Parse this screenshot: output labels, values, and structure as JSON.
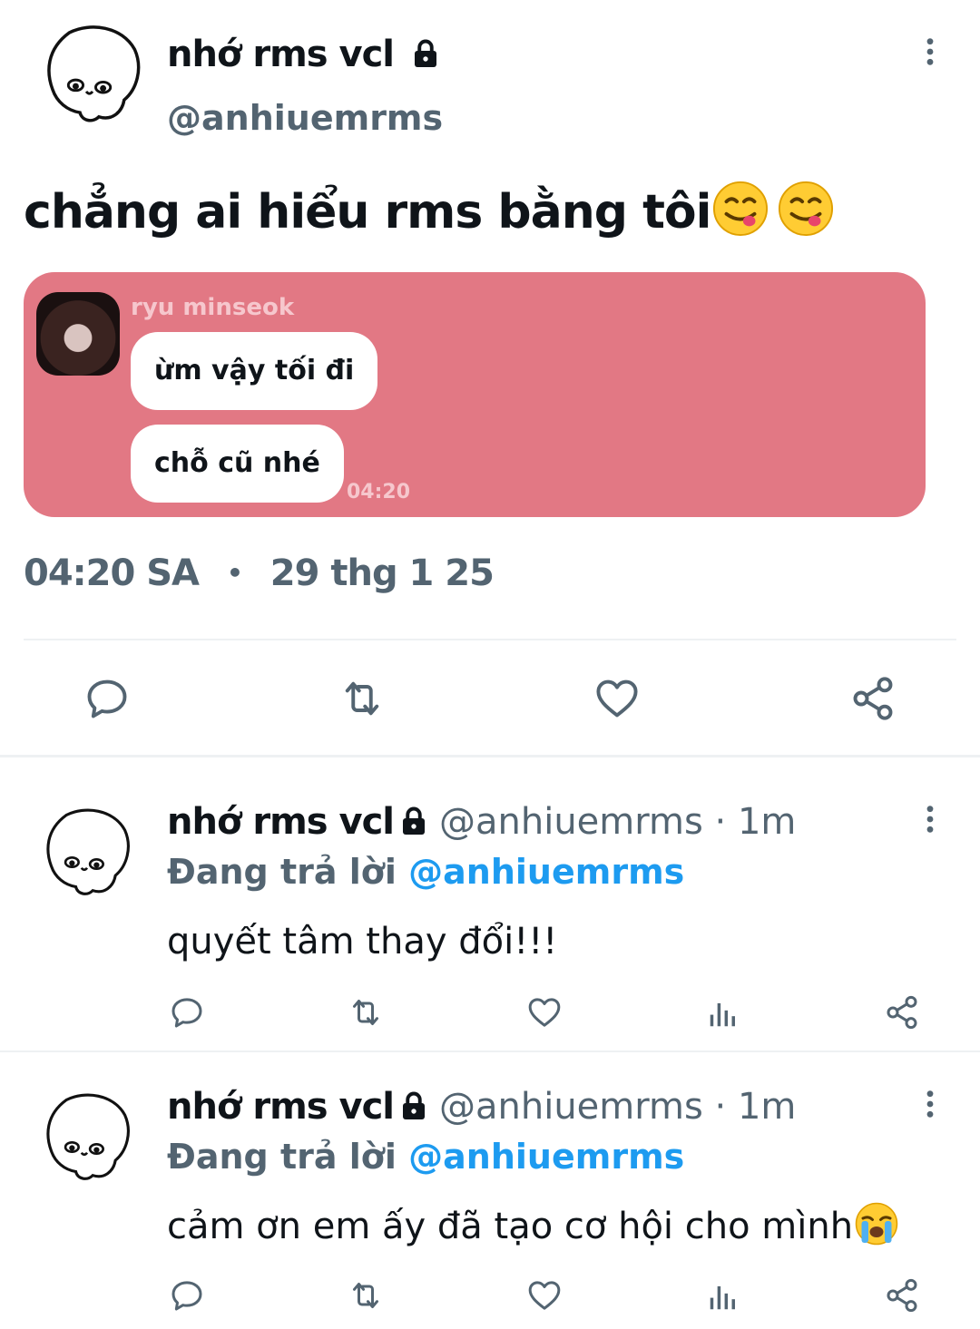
{
  "main_tweet": {
    "display_name": "nhớ rms vcl",
    "handle": "@anhiuemrms",
    "text": "chẳng ai hiểu rms bằng tôi",
    "time": "04:20 SA",
    "separator": "•",
    "date": "29 thg 1 25"
  },
  "chat_image": {
    "background": "#e27884",
    "sender_name": "ryu minseok",
    "messages": [
      "ừm vậy tối đi",
      "chỗ cũ nhé"
    ],
    "timestamp": "04:20"
  },
  "replies": [
    {
      "display_name": "nhớ rms vcl",
      "handle": "@anhiuemrms",
      "dot": "·",
      "age": "1m",
      "replying_prefix": "Đang trả lời",
      "replying_to": "@anhiuemrms",
      "text": "quyết tâm thay đổi!!!"
    },
    {
      "display_name": "nhớ rms vcl",
      "handle": "@anhiuemrms",
      "dot": "·",
      "age": "1m",
      "replying_prefix": "Đang trả lời",
      "replying_to": "@anhiuemrms",
      "text": "cảm ơn em ấy đã tạo cơ hội cho mình"
    }
  ],
  "icons": {
    "lock": "lock-icon",
    "more": "more-vertical-icon",
    "reply": "reply-icon",
    "retweet": "retweet-icon",
    "like": "heart-icon",
    "views": "views-icon",
    "share": "share-icon",
    "emoji_yum": "face-savoring-food-emoji",
    "emoji_cry": "loudly-crying-face-emoji"
  },
  "colors": {
    "text": "#0f1419",
    "muted": "#536471",
    "link": "#1d9bf0",
    "divider": "#eef1f3"
  }
}
